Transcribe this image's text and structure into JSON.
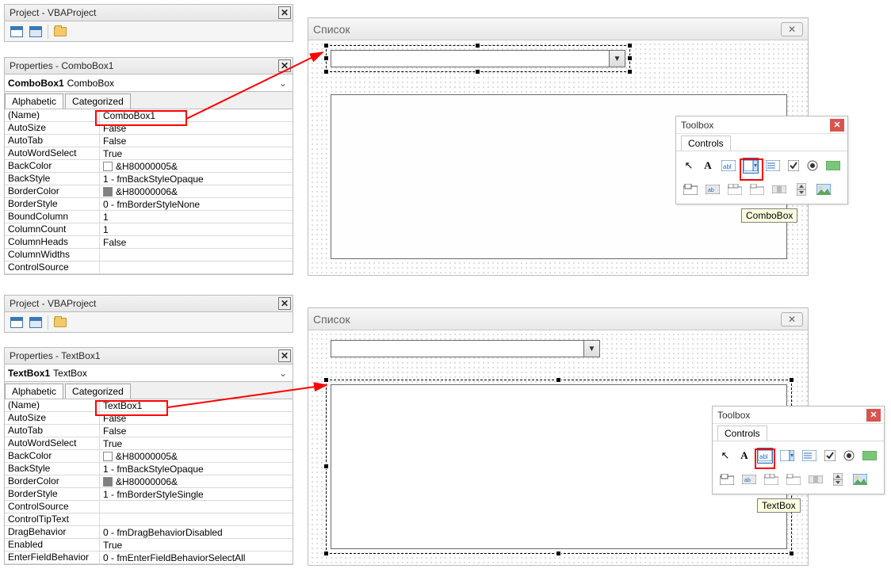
{
  "top": {
    "project_title": "Project - VBAProject",
    "properties_title": "Properties - ComboBox1",
    "object_name": "ComboBox1",
    "object_class": "ComboBox",
    "tabs": {
      "alphabetic": "Alphabetic",
      "categorized": "Categorized"
    },
    "props": [
      {
        "k": "(Name)",
        "v": "ComboBox1"
      },
      {
        "k": "AutoSize",
        "v": "False"
      },
      {
        "k": "AutoTab",
        "v": "False"
      },
      {
        "k": "AutoWordSelect",
        "v": "True"
      },
      {
        "k": "BackColor",
        "v": "&H80000005&",
        "swatch": "white"
      },
      {
        "k": "BackStyle",
        "v": "1 - fmBackStyleOpaque"
      },
      {
        "k": "BorderColor",
        "v": "&H80000006&",
        "swatch": "gray"
      },
      {
        "k": "BorderStyle",
        "v": "0 - fmBorderStyleNone"
      },
      {
        "k": "BoundColumn",
        "v": "1"
      },
      {
        "k": "ColumnCount",
        "v": "1"
      },
      {
        "k": "ColumnHeads",
        "v": "False"
      },
      {
        "k": "ColumnWidths",
        "v": ""
      },
      {
        "k": "ControlSource",
        "v": ""
      }
    ],
    "form_caption": "Список",
    "toolbox": {
      "title": "Toolbox",
      "tab": "Controls",
      "tooltip": "ComboBox"
    }
  },
  "bottom": {
    "project_title": "Project - VBAProject",
    "properties_title": "Properties - TextBox1",
    "object_name": "TextBox1",
    "object_class": "TextBox",
    "tabs": {
      "alphabetic": "Alphabetic",
      "categorized": "Categorized"
    },
    "props": [
      {
        "k": "(Name)",
        "v": "TextBox1"
      },
      {
        "k": "AutoSize",
        "v": "False"
      },
      {
        "k": "AutoTab",
        "v": "False"
      },
      {
        "k": "AutoWordSelect",
        "v": "True"
      },
      {
        "k": "BackColor",
        "v": "&H80000005&",
        "swatch": "white"
      },
      {
        "k": "BackStyle",
        "v": "1 - fmBackStyleOpaque"
      },
      {
        "k": "BorderColor",
        "v": "&H80000006&",
        "swatch": "gray"
      },
      {
        "k": "BorderStyle",
        "v": "1 - fmBorderStyleSingle"
      },
      {
        "k": "ControlSource",
        "v": ""
      },
      {
        "k": "ControlTipText",
        "v": ""
      },
      {
        "k": "DragBehavior",
        "v": "0 - fmDragBehaviorDisabled"
      },
      {
        "k": "Enabled",
        "v": "True"
      },
      {
        "k": "EnterFieldBehavior",
        "v": "0 - fmEnterFieldBehaviorSelectAll"
      }
    ],
    "form_caption": "Список",
    "toolbox": {
      "title": "Toolbox",
      "tab": "Controls",
      "tooltip": "TextBox"
    }
  }
}
